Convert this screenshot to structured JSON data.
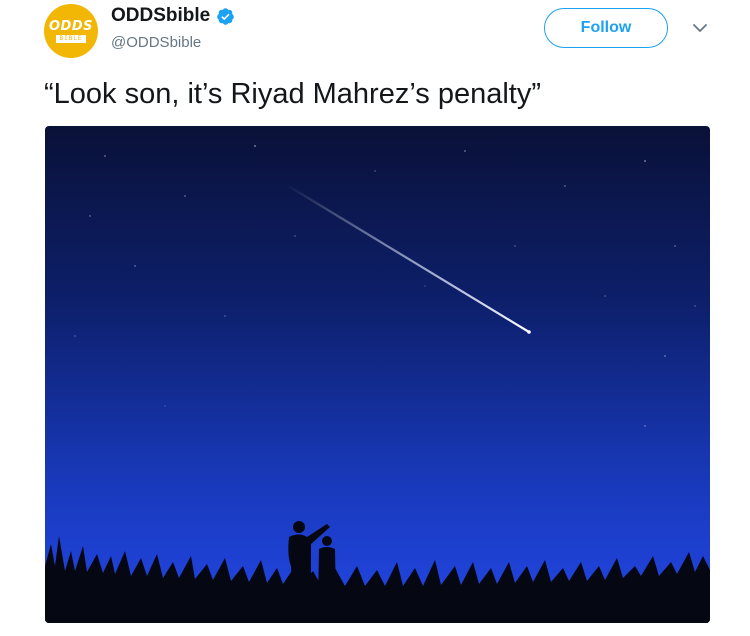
{
  "account": {
    "display_name": "ODDSbible",
    "handle": "@ODDSbible",
    "avatar_text": "ODDS",
    "avatar_subtext": "BIBLE",
    "verified": true
  },
  "follow_button": {
    "label": "Follow"
  },
  "tweet": {
    "text": "“Look son, it’s Riyad Mahrez’s penalty”"
  },
  "media": {
    "description_icon": "shooting-star-night-sky-image"
  },
  "icons": {
    "verified": "verified-badge-icon",
    "menu": "chevron-down-icon"
  },
  "colors": {
    "accent": "#1da1f2",
    "avatar_bg": "#f2b705",
    "text_primary": "#14171a",
    "text_secondary": "#657786"
  }
}
